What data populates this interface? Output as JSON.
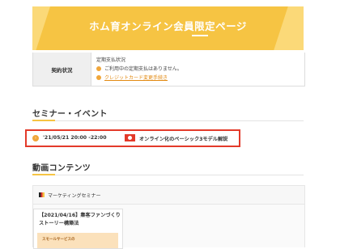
{
  "banner": {
    "title": "ホム育オンライン会員限定ページ"
  },
  "contract": {
    "label": "契約状況",
    "heading": "定期支払状況",
    "message": "ご利用中の定期支払はありません。",
    "link": "クレジットカード変更手続き"
  },
  "seminar_section": {
    "title": "セミナー・イベント",
    "item": {
      "datetime": "'21/05/21 20:00 -22:00",
      "title": "オンライン化のベーシック3モデル解説"
    }
  },
  "video_section": {
    "title": "動画コンテンツ",
    "category": "マーケティングセミナー",
    "card": {
      "title_line1": "【2021/04/16】集客ファンづくり",
      "title_line2": "ストーリー構築法",
      "thumb_text": "スモールサービスの"
    }
  },
  "colors": {
    "accent": "#f6c443",
    "highlight_border": "#e33a2a",
    "bullet": "#f0a63a",
    "link": "#e28a12"
  }
}
